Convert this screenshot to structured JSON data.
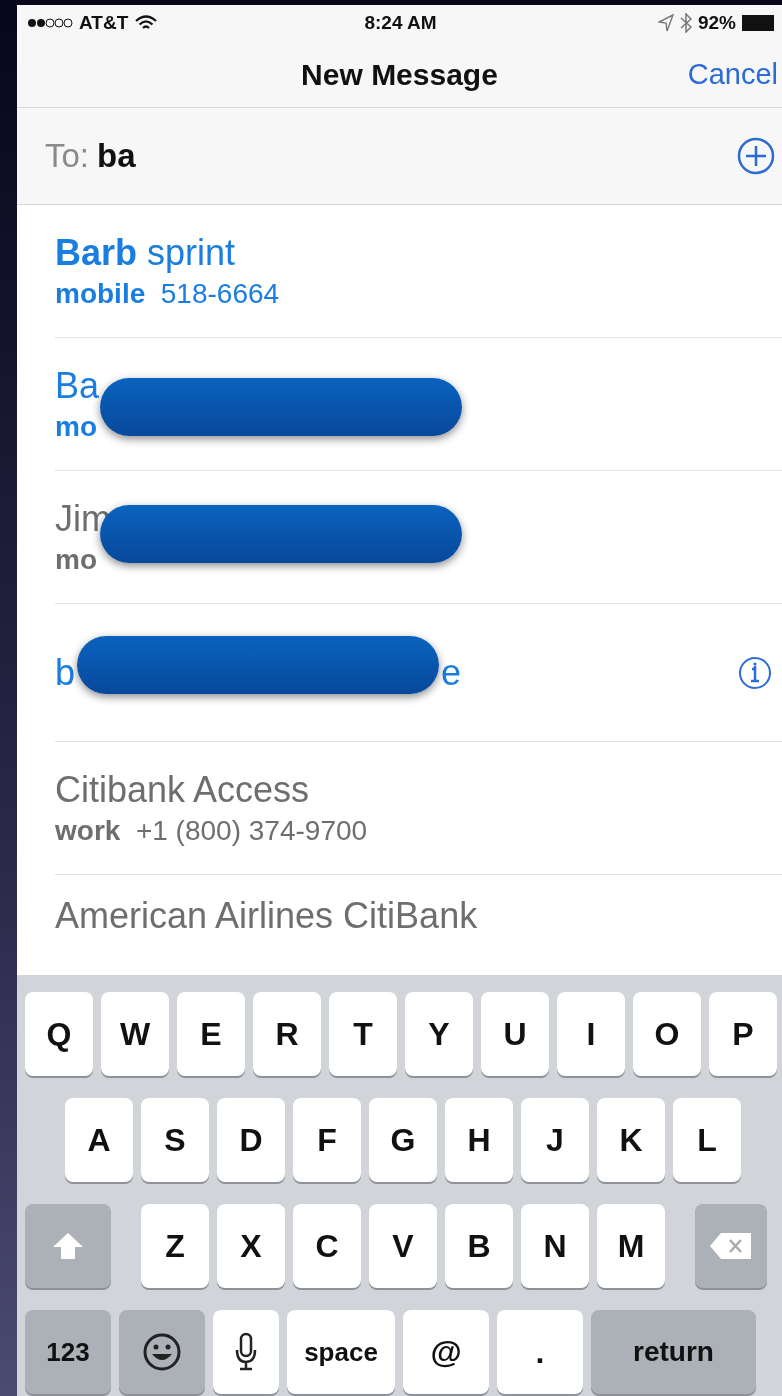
{
  "status_bar": {
    "carrier": "AT&T",
    "time": "8:24 AM",
    "battery": "92%"
  },
  "nav": {
    "title": "New Message",
    "action": "Cancel"
  },
  "to_field": {
    "label": "To:",
    "value": "ba"
  },
  "suggestions": [
    {
      "name": "**Barb** sprint",
      "detail_label": "mobile",
      "detail_value": "518-6664",
      "color": "#1a7ee0",
      "redacted": false,
      "info": false
    },
    {
      "name": "Ba",
      "detail_label": "mo",
      "color": "#1a7ee0",
      "redacted": true,
      "info": false
    },
    {
      "name": "Jim",
      "detail_label": "mo",
      "color": "#6e6e6e",
      "redacted": true,
      "info": false
    },
    {
      "name": "b",
      "name_tail": "e",
      "color": "#1a7ee0",
      "redacted": true,
      "info": true
    },
    {
      "name": "Citibank Access",
      "detail_label": "work",
      "detail_value": "+1 (800) 374-9700",
      "color": "#6e6e6e",
      "redacted": false,
      "info": false
    },
    {
      "name": "American Airlines CitiBank",
      "color": "#6e6e6e",
      "redacted": false,
      "info": false
    }
  ],
  "keyboard": {
    "rows": [
      {
        "keys": [
          {
            "kind": "letter",
            "label": "Q"
          },
          {
            "kind": "letter",
            "label": "W"
          },
          {
            "kind": "letter",
            "label": "E"
          },
          {
            "kind": "letter",
            "label": "R"
          },
          {
            "kind": "letter",
            "label": "T"
          },
          {
            "kind": "letter",
            "label": "Y"
          },
          {
            "kind": "letter",
            "label": "U"
          },
          {
            "kind": "letter",
            "label": "I"
          },
          {
            "kind": "letter",
            "label": "O"
          },
          {
            "kind": "letter",
            "label": "P"
          }
        ]
      },
      {
        "keys": [
          {
            "kind": "letter",
            "label": "A"
          },
          {
            "kind": "letter",
            "label": "S"
          },
          {
            "kind": "letter",
            "label": "D"
          },
          {
            "kind": "letter",
            "label": "F"
          },
          {
            "kind": "letter",
            "label": "G"
          },
          {
            "kind": "letter",
            "label": "H"
          },
          {
            "kind": "letter",
            "label": "J"
          },
          {
            "kind": "letter",
            "label": "K"
          },
          {
            "kind": "letter",
            "label": "L"
          }
        ]
      },
      {
        "keys": [
          {
            "kind": "shift"
          },
          {
            "kind": "letter",
            "label": "Z"
          },
          {
            "kind": "letter",
            "label": "X"
          },
          {
            "kind": "letter",
            "label": "C"
          },
          {
            "kind": "letter",
            "label": "V"
          },
          {
            "kind": "letter",
            "label": "B"
          },
          {
            "kind": "letter",
            "label": "N"
          },
          {
            "kind": "letter",
            "label": "M"
          },
          {
            "kind": "delete"
          }
        ]
      },
      {
        "keys": [
          {
            "kind": "mode",
            "label": "123"
          },
          {
            "kind": "emoji"
          },
          {
            "kind": "mic"
          },
          {
            "kind": "space",
            "label": "space"
          },
          {
            "kind": "letter",
            "label": "@"
          },
          {
            "kind": "letter",
            "label": "."
          },
          {
            "kind": "return",
            "label": "return"
          }
        ]
      }
    ]
  }
}
